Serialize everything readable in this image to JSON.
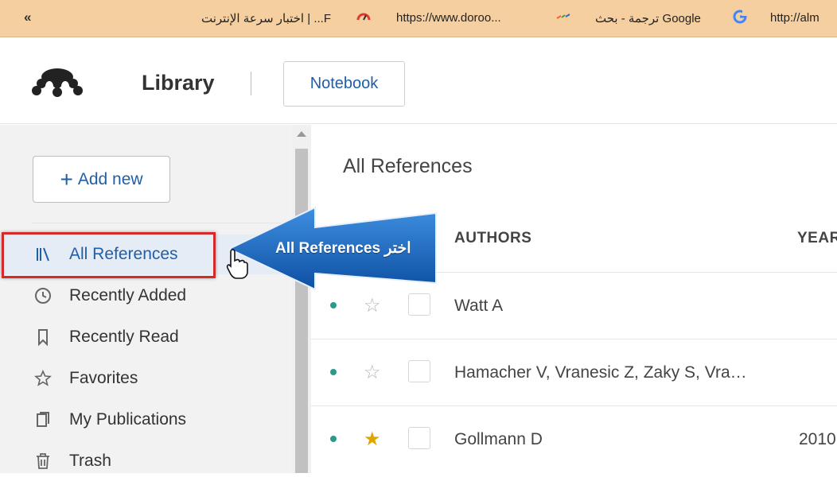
{
  "bookmarks": {
    "toggle": "«",
    "items": [
      {
        "label": "اختبار سرعة الإنترنت | ...F",
        "icon": "speedtest-icon"
      },
      {
        "label": "https://www.doroo...",
        "icon": "doroob-icon"
      },
      {
        "label": "ترجمة - بحث Google",
        "icon": "google-icon"
      },
      {
        "label": "http://alm",
        "icon": "link-icon"
      }
    ]
  },
  "header": {
    "title": "Library",
    "notebook": "Notebook",
    "colors": {
      "link": "#1f5fa8"
    }
  },
  "sidebar": {
    "add_new": "Add new",
    "items": [
      {
        "label": "All References",
        "icon": "library-icon",
        "active": true
      },
      {
        "label": "Recently Added",
        "icon": "clock-icon"
      },
      {
        "label": "Recently Read",
        "icon": "bookmark-icon"
      },
      {
        "label": "Favorites",
        "icon": "star-icon"
      },
      {
        "label": "My Publications",
        "icon": "publications-icon"
      },
      {
        "label": "Trash",
        "icon": "trash-icon"
      }
    ]
  },
  "main": {
    "title": "All References",
    "columns": {
      "authors": "AUTHORS",
      "year": "YEAR"
    },
    "rows": [
      {
        "authors": "Watt A",
        "year": "",
        "favorite": false
      },
      {
        "authors": "Hamacher V, Vranesic Z, Zaky S, Vra…",
        "year": "",
        "favorite": false
      },
      {
        "authors": "Gollmann D",
        "year": "2010",
        "favorite": true
      }
    ]
  },
  "annotation": {
    "text": "اختر All References",
    "highlight_color": "#d42a2a",
    "arrow_color": "#1565c0"
  }
}
